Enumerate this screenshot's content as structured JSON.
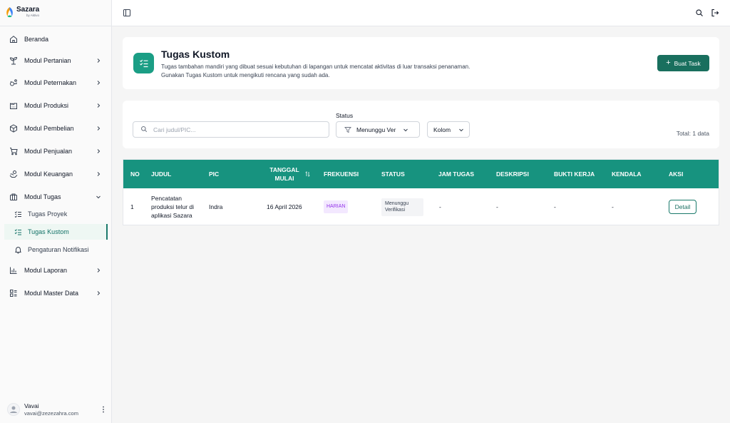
{
  "app": {
    "logo_name": "Sazara",
    "logo_sub": "by Aktivo"
  },
  "sidebar": {
    "items": [
      {
        "label": "Beranda",
        "icon": "home-icon"
      },
      {
        "label": "Modul Pertanian",
        "icon": "sprout-icon"
      },
      {
        "label": "Modul Peternakan",
        "icon": "livestock-icon"
      },
      {
        "label": "Modul Produksi",
        "icon": "factory-icon"
      },
      {
        "label": "Modul Pembelian",
        "icon": "box-icon"
      },
      {
        "label": "Modul Penjualan",
        "icon": "cart-icon"
      },
      {
        "label": "Modul Keuangan",
        "icon": "money-icon"
      },
      {
        "label": "Modul Tugas",
        "icon": "briefcase-icon"
      },
      {
        "label": "Modul Laporan",
        "icon": "chart-icon"
      },
      {
        "label": "Modul Master Data",
        "icon": "grid-icon"
      }
    ],
    "sub_items": [
      {
        "label": "Tugas Proyek",
        "icon": "checklist-icon"
      },
      {
        "label": "Tugas Kustom",
        "icon": "checklist-icon"
      },
      {
        "label": "Pengaturan Notifikasi",
        "icon": "bell-icon"
      }
    ],
    "active_sub": "Tugas Kustom"
  },
  "user": {
    "name": "Vavai",
    "email": "vavai@zezezahra.com"
  },
  "header": {
    "title": "Tugas Kustom",
    "desc_line1": "Tugas tambahan mandiri yang dibuat sesuai kebutuhan di lapangan untuk mencatat aktivitas di luar transaksi penanaman.",
    "desc_line2": "Gunakan Tugas Kustom untuk mengikuti rencana yang sudah ada.",
    "create_button": "Buat Task"
  },
  "filters": {
    "search_placeholder": "Cari judul/PIC...",
    "status_label": "Status",
    "status_value": "Menunggu Ver",
    "column_button": "Kolom",
    "total": "Total: 1 data"
  },
  "table": {
    "headers": {
      "no": "NO",
      "judul": "JUDUL",
      "pic": "PIC",
      "tanggal_line1": "TANGGAL",
      "tanggal_line2": "MULAI",
      "frekuensi": "FREKUENSI",
      "status": "STATUS",
      "jam": "JAM TUGAS",
      "deskripsi": "DESKRIPSI",
      "bukti": "BUKTI KERJA",
      "kendala": "KENDALA",
      "aksi": "AKSI"
    },
    "rows": [
      {
        "no": "1",
        "judul_line1": "Pencatatan",
        "judul_line2": "produksi telur di",
        "judul_line3": "aplikasi Sazara",
        "pic": "Indra",
        "tanggal": "16 April 2026",
        "frekuensi": "HARIAN",
        "status_line1": "Menunggu",
        "status_line2": "Verifikasi",
        "jam": "-",
        "deskripsi": "-",
        "bukti": "-",
        "kendala": "-",
        "aksi": "Detail"
      }
    ]
  },
  "colors": {
    "primary": "#196f5e",
    "table_header": "#17937f",
    "header_icon": "#1b9e85",
    "badge_harian": "#9333ea"
  }
}
